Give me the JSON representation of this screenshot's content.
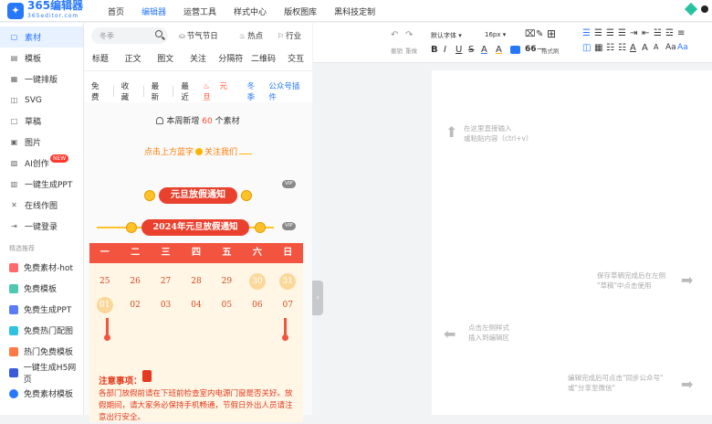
{
  "brand": {
    "logo_text": "365编辑器",
    "logo_domain": "365editor.com",
    "logo_icon": "bird-logo-icon",
    "color": "#2878ff"
  },
  "nav": {
    "items": [
      "首页",
      "编辑器",
      "运营工具",
      "样式中心",
      "版权图库",
      "黑科技定制"
    ],
    "active": "编辑器"
  },
  "sidebar": {
    "items": [
      {
        "label": "素材",
        "icon": "material-icon",
        "active": true
      },
      {
        "label": "模板",
        "icon": "template-icon"
      },
      {
        "label": "一键排版",
        "icon": "layout-icon"
      },
      {
        "label": "SVG",
        "icon": "svg-icon"
      },
      {
        "label": "草稿",
        "icon": "draft-icon"
      },
      {
        "label": "图片",
        "icon": "image-icon"
      },
      {
        "label": "AI创作",
        "icon": "ai-icon",
        "badge": "NEW"
      },
      {
        "label": "一键生成PPT",
        "icon": "ppt-icon"
      },
      {
        "label": "在线作图",
        "icon": "design-icon"
      },
      {
        "label": "一键登录",
        "icon": "login-icon"
      }
    ],
    "section_title": "精选推荐",
    "recommend": [
      {
        "label": "免费素材-hot",
        "color": "#ff6b6b"
      },
      {
        "label": "免费模板",
        "color": "#4ec9b0"
      },
      {
        "label": "免费生成PPT",
        "color": "#5b7cfa"
      },
      {
        "label": "免费热门配图",
        "color": "#2ec4e0"
      },
      {
        "label": "热门免费模板",
        "color": "#ff7a45"
      },
      {
        "label": "一键生成H5网页",
        "color": "#3b5bdb"
      },
      {
        "label": "免费素材模板",
        "color": "#2878ff"
      }
    ]
  },
  "panel": {
    "search_placeholder": "冬季",
    "quick": [
      {
        "label": "节气节日",
        "icon": "cake-icon"
      },
      {
        "label": "热点",
        "icon": "flame-icon"
      },
      {
        "label": "行业",
        "icon": "industry-icon"
      }
    ],
    "categories": [
      "标题",
      "正文",
      "图文",
      "关注",
      "分隔符",
      "二维码",
      "交互"
    ],
    "filters": [
      "免费",
      "收藏",
      "最新",
      "最近"
    ],
    "tags": [
      {
        "label": "元旦",
        "kind": "red"
      },
      {
        "label": "冬季",
        "kind": "blue"
      },
      {
        "label": "公众号插件",
        "kind": "blue"
      }
    ],
    "weekly": {
      "prefix": "本周新增",
      "count": "60",
      "suffix": "个素材"
    },
    "promo": {
      "before": "点击上方蓝字",
      "after": "关注我们"
    },
    "vip": "VIP",
    "banner1": "元旦放假通知",
    "banner2": "2024年元旦放假通知",
    "calendar": {
      "weekdays": [
        "一",
        "二",
        "三",
        "四",
        "五",
        "六",
        "日"
      ],
      "row1": [
        {
          "d": "25"
        },
        {
          "d": "26"
        },
        {
          "d": "27"
        },
        {
          "d": "28"
        },
        {
          "d": "29"
        },
        {
          "d": "30",
          "hl": true
        },
        {
          "d": "31",
          "hl": true
        }
      ],
      "row2": [
        {
          "d": "01",
          "hl": true
        },
        {
          "d": "02"
        },
        {
          "d": "03"
        },
        {
          "d": "04"
        },
        {
          "d": "05"
        },
        {
          "d": "06"
        },
        {
          "d": "07"
        }
      ]
    },
    "notice_title": "注意事项：",
    "notice_body": "各部门放假前请在下班前检查室内电源门窗是否关好。放假期间，请大家务必保持手机畅通，节假日外出人员请注意出行安全。"
  },
  "toolbar": {
    "undo": "撤销",
    "redo": "重做",
    "font": "默认字体",
    "size": "16px",
    "format_brush": "格式刷",
    "row1": [
      "B",
      "I",
      "U",
      "S",
      "A",
      "A",
      "66",
      "—"
    ]
  },
  "editor": {
    "hint_input": "在这里直接输入\n或粘贴内容（ctrl+v）",
    "hint_save": "保存草稿完成后在左侧\n\"草稿\"中点击使用",
    "hint_style": "点击左侧样式\n插入到编辑区",
    "hint_publish": "编辑完成后可点击\"同步公众号\"\n或\"分享至微信\"",
    "collapse_label": "‹"
  }
}
